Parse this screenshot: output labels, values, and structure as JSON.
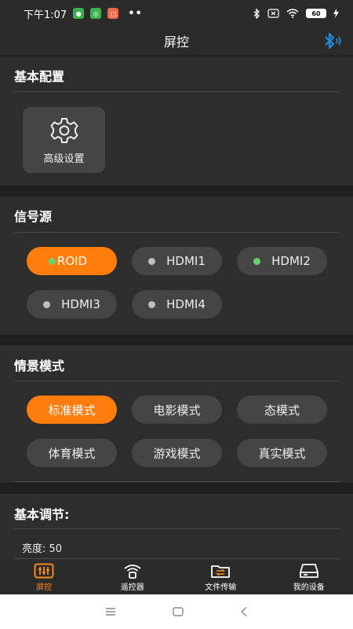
{
  "status_bar": {
    "time": "下午1:07",
    "dots": "••",
    "battery": "60"
  },
  "header": {
    "title": "屏控"
  },
  "basic_config": {
    "title": "基本配置",
    "advanced_settings_label": "高级设置"
  },
  "signal_source": {
    "title": "信号源",
    "items": [
      {
        "label": "ROID",
        "active": true,
        "indicator": "green"
      },
      {
        "label": "HDMI1",
        "active": false,
        "indicator": "gray"
      },
      {
        "label": "HDMI2",
        "active": false,
        "indicator": "green"
      },
      {
        "label": "HDMI3",
        "active": false,
        "indicator": "gray"
      },
      {
        "label": "HDMI4",
        "active": false,
        "indicator": "gray"
      }
    ]
  },
  "scene_mode": {
    "title": "情景模式",
    "items": [
      {
        "label": "标准模式",
        "active": true
      },
      {
        "label": "电影模式",
        "active": false
      },
      {
        "label": "态模式",
        "active": false
      },
      {
        "label": "体育模式",
        "active": false
      },
      {
        "label": "游戏模式",
        "active": false
      },
      {
        "label": "真实模式",
        "active": false
      }
    ]
  },
  "basic_adjust": {
    "title": "基本调节:",
    "brightness_label": "亮度: 50"
  },
  "tabs": [
    {
      "label": "屏控",
      "active": true,
      "icon": "sliders-icon"
    },
    {
      "label": "遥控器",
      "active": false,
      "icon": "remote-signal-icon"
    },
    {
      "label": "文件传输",
      "active": false,
      "icon": "folder-transfer-icon"
    },
    {
      "label": "我的设备",
      "active": false,
      "icon": "device-icon"
    }
  ],
  "colors": {
    "accent": "#ff7d0d",
    "bluetooth": "#1e88e5",
    "indicator_green": "#6cd36c"
  }
}
